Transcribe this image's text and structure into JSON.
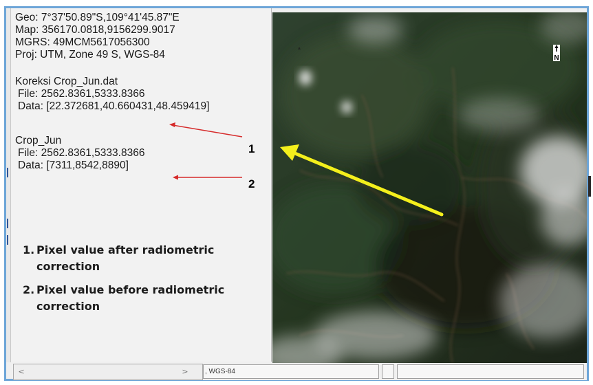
{
  "info_panel": {
    "geo": "Geo: 7°37'50.89\"S,109°41'45.87\"E",
    "map": "Map: 356170.0818,9156299.9017",
    "mgrs": "MGRS: 49MCM5617056300",
    "proj": "Proj: UTM, Zone 49 S, WGS-84",
    "corrected_layer": {
      "name": "Koreksi Crop_Jun.dat",
      "file": "File: 2562.8361,5333.8366",
      "data": "Data: [22.372681,40.660431,48.459419]"
    },
    "original_layer": {
      "name": "Crop_Jun",
      "file": "File: 2562.8361,5333.8366",
      "data": "Data: [7311,8542,8890]"
    }
  },
  "annotations": {
    "label_1": "1",
    "label_2": "2",
    "arrow_color": "#d62b2b",
    "pointer_arrow_color": "#f4ef1c"
  },
  "legend": [
    {
      "num": "1.",
      "text": "Pixel value after radiometric correction"
    },
    {
      "num": "2.",
      "text": "Pixel value before radiometric correction"
    }
  ],
  "map_view": {
    "north_label": "N"
  },
  "status_bar": {
    "projection": ", WGS-84",
    "cell_2": "",
    "cell_3": ""
  },
  "scrollbar": {
    "left": "<",
    "right": ">"
  }
}
